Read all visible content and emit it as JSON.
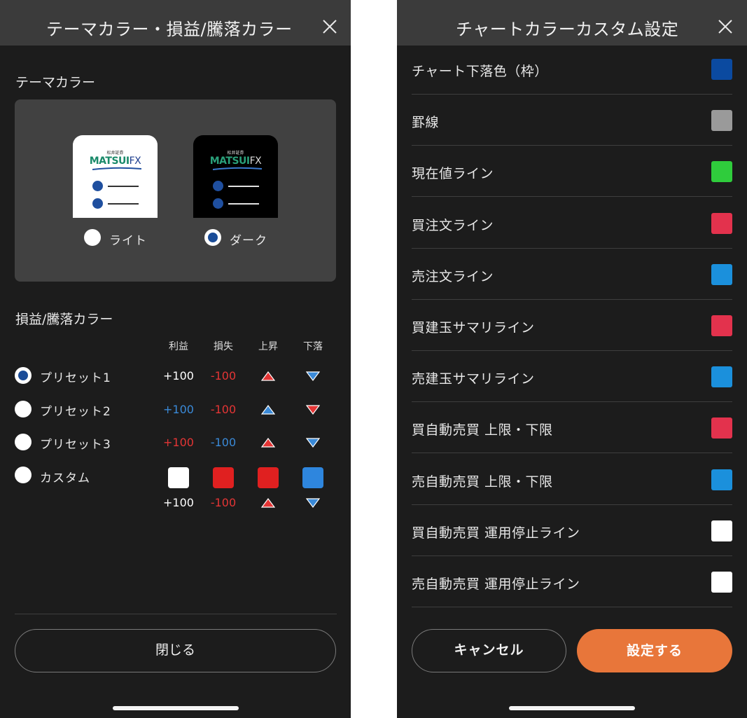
{
  "left_panel": {
    "title": "テーマカラー・損益/騰落カラー",
    "theme_section_title": "テーマカラー",
    "logo_small": "松井証券",
    "logo_main": "MATSUI",
    "logo_fx": "FX",
    "theme_options": [
      {
        "label": "ライト",
        "selected": false
      },
      {
        "label": "ダーク",
        "selected": true
      }
    ],
    "pl_section_title": "損益/騰落カラー",
    "columns": [
      "利益",
      "損失",
      "上昇",
      "下落"
    ],
    "presets": [
      {
        "label": "プリセット1",
        "selected": true,
        "profit": "+100",
        "loss": "-100",
        "profit_color": "#ffffff",
        "loss_color": "#e43535",
        "up_color": "#e43535",
        "down_color": "#3a8ad8"
      },
      {
        "label": "プリセット2",
        "selected": false,
        "profit": "+100",
        "loss": "-100",
        "profit_color": "#3a8ad8",
        "loss_color": "#e43535",
        "up_color": "#3a8ad8",
        "down_color": "#e43535"
      },
      {
        "label": "プリセット3",
        "selected": false,
        "profit": "+100",
        "loss": "-100",
        "profit_color": "#e43535",
        "loss_color": "#3a8ad8",
        "up_color": "#e43535",
        "down_color": "#3a8ad8"
      }
    ],
    "custom": {
      "label": "カスタム",
      "selected": false,
      "swatches": [
        "#ffffff",
        "#e02020",
        "#e02020",
        "#2e86de"
      ],
      "profit": "+100",
      "loss": "-100",
      "profit_color": "#ffffff",
      "loss_color": "#e43535",
      "up_color": "#e43535",
      "down_color": "#3a8ad8"
    },
    "close_button": "閉じる"
  },
  "right_panel": {
    "title": "チャートカラーカスタム設定",
    "rows": [
      {
        "label": "チャート下落色（枠）",
        "color": "#0b4aa0"
      },
      {
        "label": "罫線",
        "color": "#9a9a9a"
      },
      {
        "label": "現在値ライン",
        "color": "#2fcc3c"
      },
      {
        "label": "買注文ライン",
        "color": "#e3324d"
      },
      {
        "label": "売注文ライン",
        "color": "#1b90dc"
      },
      {
        "label": "買建玉サマリライン",
        "color": "#e3324d"
      },
      {
        "label": "売建玉サマリライン",
        "color": "#1b90dc"
      },
      {
        "label": "買自動売買 上限・下限",
        "color": "#e3324d"
      },
      {
        "label": "売自動売買 上限・下限",
        "color": "#1b90dc"
      },
      {
        "label": "買自動売買 運用停止ライン",
        "color": "#ffffff"
      },
      {
        "label": "売自動売買 運用停止ライン",
        "color": "#ffffff"
      }
    ],
    "cancel_button": "キャンセル",
    "apply_button": "設定する",
    "accent": "#e8763a"
  }
}
